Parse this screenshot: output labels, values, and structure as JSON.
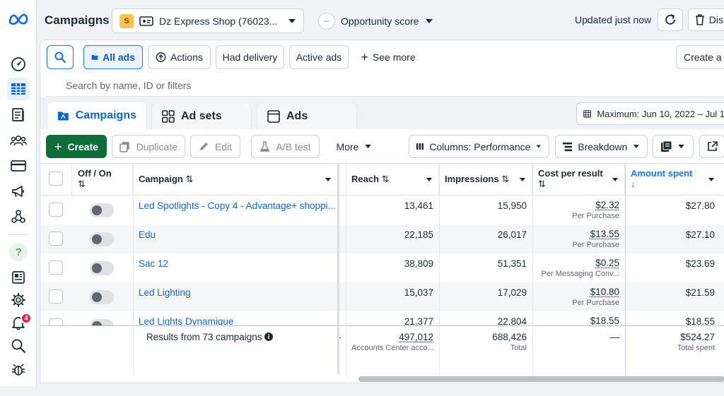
{
  "nav": {
    "active": "campaigns-table",
    "notification_count": "4"
  },
  "header": {
    "title": "Campaigns",
    "account_initial": "S",
    "account_name": "Dz Express Shop (76023...",
    "opportunity_value": "--",
    "opportunity_label": "Opportunity score",
    "updated_text": "Updated just now",
    "discard_label": "Dis"
  },
  "filters": {
    "all_ads": "All ads",
    "actions": "Actions",
    "had_delivery": "Had delivery",
    "active_ads": "Active ads",
    "see_more": "See more",
    "create_view": "Create a v"
  },
  "search": {
    "placeholder": "Search by name, ID or filters"
  },
  "tabs": [
    {
      "label": "Campaigns"
    },
    {
      "label": "Ad sets"
    },
    {
      "label": "Ads"
    }
  ],
  "date_range": "Maximum: Jun 10, 2022 – Jul 1",
  "toolbar": {
    "create": "Create",
    "duplicate": "Duplicate",
    "edit": "Edit",
    "ab_test": "A/B test",
    "more": "More",
    "columns": "Columns: Performance",
    "breakdown": "Breakdown"
  },
  "columns": {
    "off_on": "Off / On",
    "campaign": "Campaign",
    "reach": "Reach",
    "impressions": "Impressions",
    "cost_per_result": "Cost per result",
    "amount_spent": "Amount spent"
  },
  "rows": [
    {
      "name": "Led Spotlights - Copy 4 - Advantage+ shoppi...",
      "reach": "13,461",
      "impressions": "15,950",
      "cpr": "$2.32",
      "cpr_sub": "Per Purchase",
      "spent": "$27.80"
    },
    {
      "name": "Edu",
      "reach": "22,185",
      "impressions": "26,017",
      "cpr": "$13.55",
      "cpr_sub": "Per Purchase",
      "spent": "$27.10"
    },
    {
      "name": "Sac 12",
      "reach": "38,809",
      "impressions": "51,351",
      "cpr": "$0.25",
      "cpr_sub": "Per Messaging Conv...",
      "spent": "$23.69"
    },
    {
      "name": "Led Lighting",
      "reach": "15,037",
      "impressions": "17,029",
      "cpr": "$10.80",
      "cpr_sub": "Per Purchase",
      "spent": "$21.59"
    },
    {
      "name": "Led Lights Dynamique",
      "reach": "21,377",
      "impressions": "22,804",
      "cpr": "$18.55",
      "cpr_sub": "",
      "spent": "$18.55"
    }
  ],
  "totals": {
    "label": "Results from 73 campaigns",
    "dash": "-",
    "reach": "497,012",
    "reach_sub": "Accounts Center acco...",
    "impressions": "688,426",
    "impressions_sub": "Total",
    "cpr": "—",
    "spent": "$524.27",
    "spent_sub": "Total spent"
  },
  "colors": {
    "primary": "#1877f2",
    "create_green": "#0e6e3a",
    "link": "#1366d6"
  }
}
